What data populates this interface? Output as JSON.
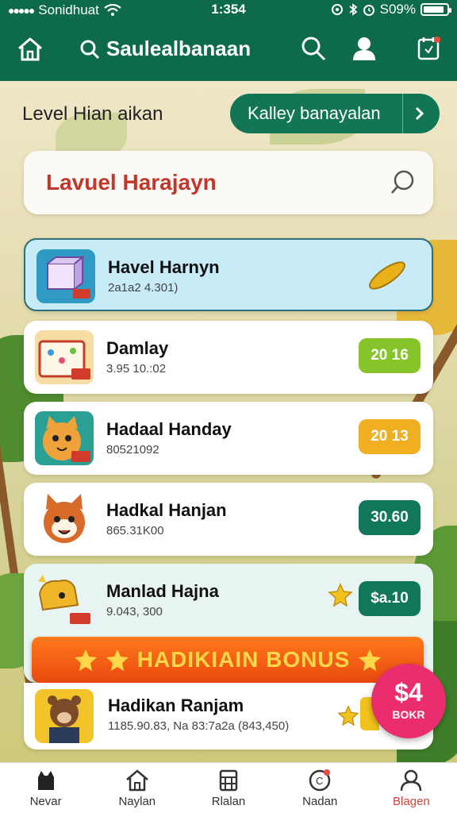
{
  "status_bar": {
    "carrier": "Sonidhuat",
    "time": "1:354",
    "battery": "S09%",
    "battery_level": 0.9
  },
  "header": {
    "title": "Saulealbanaan"
  },
  "level": {
    "label": "Level Hian aikan",
    "button_label": "Kalley banayalan"
  },
  "search": {
    "value": "Lavuel Harajayn"
  },
  "items": [
    {
      "name": "Havel Harnyn",
      "sub": "2a1a2 4.301)",
      "badge": "",
      "selected": true
    },
    {
      "name": "Damlay",
      "sub": "3.95 10.:02",
      "badge": "20 16",
      "badge_color": "#86c52a"
    },
    {
      "name": "Hadaal Handay",
      "sub": "80521092",
      "badge": "20 13",
      "badge_color": "#efaf21"
    },
    {
      "name": "Hadkal Hanjan",
      "sub": "865.31K00",
      "badge": "30.60",
      "badge_color": "#11775a"
    },
    {
      "name": "Manlad Hajna",
      "sub": "9.043, 300",
      "badge": "$a.10",
      "badge_color": "#11775a"
    }
  ],
  "bonus": {
    "label": "HADIKIAIN BONUS"
  },
  "last_item": {
    "name": "Hadikan Ranjam",
    "sub": "1185.90.83, Na 83:7a2a (843,450)"
  },
  "fab": {
    "amount": "$4",
    "label": "BOKR"
  },
  "nav": [
    {
      "label": "Nevar",
      "icon": "cat-icon"
    },
    {
      "label": "Naylan",
      "icon": "home-icon"
    },
    {
      "label": "Rlalan",
      "icon": "calculator-icon"
    },
    {
      "label": "Nadan",
      "icon": "notification-icon"
    },
    {
      "label": "Blagen",
      "icon": "profile-icon"
    }
  ],
  "colors": {
    "primary": "#0e6b4a",
    "accent_red": "#d0433a",
    "bonus_orange": "#ff7a1a",
    "fab_pink": "#ea2d6e"
  }
}
